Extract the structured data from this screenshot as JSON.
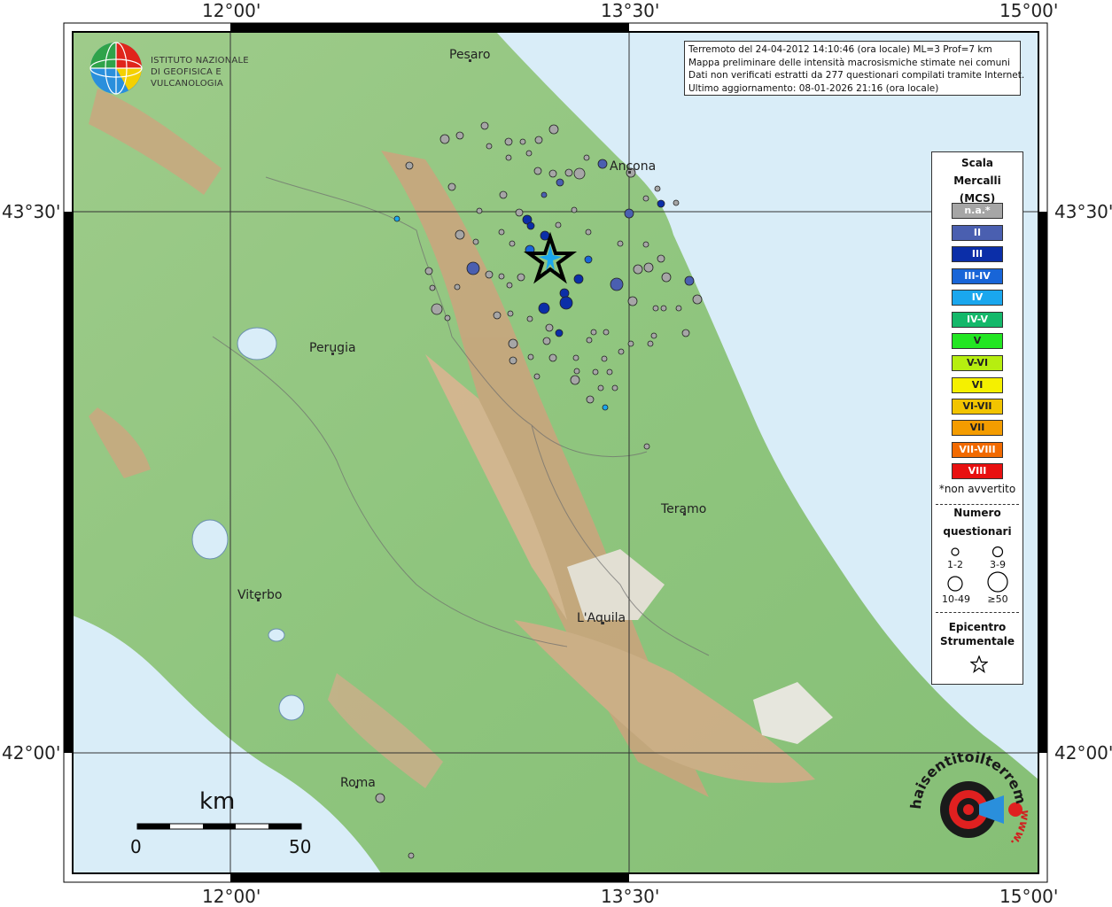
{
  "header": {
    "line1": "Terremoto del 24-04-2012 14:10:46 (ora locale) ML=3 Prof=7 km",
    "line2": "Mappa preliminare delle intensità macrosismiche stimate nei comuni",
    "line3": "Dati non verificati estratti da 277 questionari compilati tramite Internet.",
    "line4": "Ultimo aggiornamento: 08-01-2026 21:16 (ora locale)"
  },
  "logo": {
    "line1": "ISTITUTO NAZIONALE",
    "line2": "DI GEOFISICA E VULCANOLOGIA"
  },
  "axes": {
    "x_ticks": [
      "12°00'",
      "13°30'",
      "15°00'"
    ],
    "y_ticks": [
      "43°30'",
      "42°00'"
    ]
  },
  "cities": [
    {
      "name": "Pesaro"
    },
    {
      "name": "Ancona"
    },
    {
      "name": "Perugia"
    },
    {
      "name": "Teramo"
    },
    {
      "name": "Viterbo"
    },
    {
      "name": "L'Aquila"
    },
    {
      "name": "Roma"
    }
  ],
  "legend": {
    "title1": "Scala",
    "title2": "Mercalli",
    "title3": "(MCS)",
    "classes": [
      {
        "label": "n.a.*",
        "color": "#a6a6a6"
      },
      {
        "label": "II",
        "color": "#4a5fb0"
      },
      {
        "label": "III",
        "color": "#0b2ea8"
      },
      {
        "label": "III-IV",
        "color": "#1865d8"
      },
      {
        "label": "IV",
        "color": "#1aa7ee"
      },
      {
        "label": "IV-V",
        "color": "#14b86a"
      },
      {
        "label": "V",
        "color": "#22e622"
      },
      {
        "label": "V-VI",
        "color": "#b6ee10"
      },
      {
        "label": "VI",
        "color": "#f5f000"
      },
      {
        "label": "VI-VII",
        "color": "#f2c400"
      },
      {
        "label": "VII",
        "color": "#f49c00"
      },
      {
        "label": "VII-VIII",
        "color": "#f26a00"
      },
      {
        "label": "VIII",
        "color": "#e81010"
      }
    ],
    "note": "*non avvertito",
    "count_title1": "Numero",
    "count_title2": "questionari",
    "sizes": [
      "1-2",
      "3-9",
      "10-49",
      "≥50"
    ],
    "epi_title1": "Epicentro",
    "epi_title2": "Strumentale"
  },
  "scale_bar": {
    "unit": "km",
    "start": "0",
    "end": "50"
  },
  "logo_hsit": {
    "text": "haisentitoilterremoto.it",
    "prefix": "www."
  },
  "colors": {
    "sea": "#d8ecf7",
    "land_low": "#7ec27a",
    "land_mid": "#b8c48a",
    "land_high": "#c9a27a",
    "peak": "#f4f0f0"
  }
}
